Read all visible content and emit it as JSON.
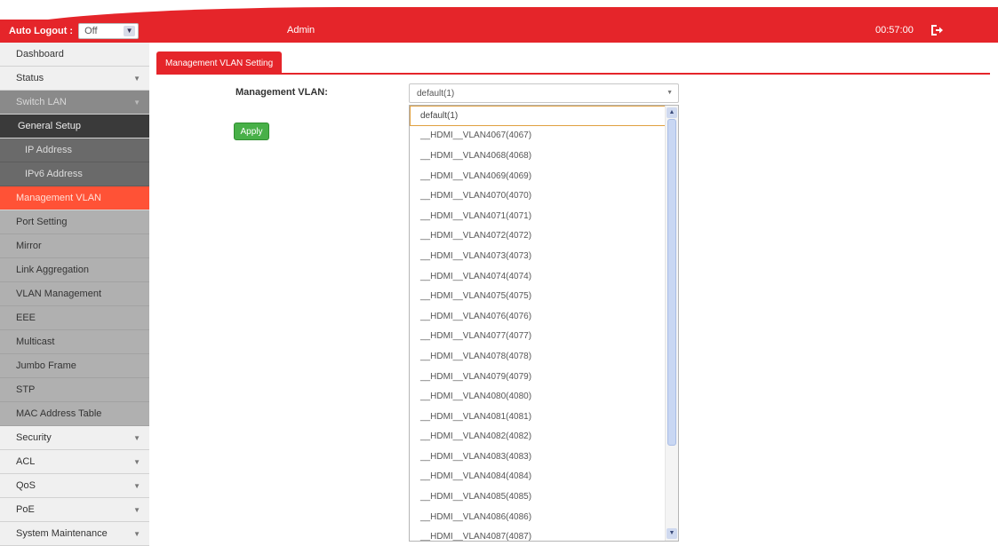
{
  "header": {
    "auto_logout_label": "Auto Logout :",
    "auto_logout_value": "Off",
    "user": "Admin",
    "time": "00:57:00",
    "logout_icon": "logout-icon",
    "color": "#e5252a"
  },
  "sidebar": {
    "items": [
      {
        "label": "Dashboard",
        "type": "normal",
        "chevron": false
      },
      {
        "label": "Status",
        "type": "normal",
        "chevron": true
      },
      {
        "label": "Switch LAN",
        "type": "section",
        "chevron": true
      },
      {
        "label": "General Setup",
        "type": "sub-header",
        "chevron": false
      },
      {
        "label": "IP Address",
        "type": "sub",
        "chevron": false
      },
      {
        "label": "IPv6 Address",
        "type": "sub",
        "chevron": false
      },
      {
        "label": "Management VLAN",
        "type": "active",
        "chevron": false
      },
      {
        "label": "Port Setting",
        "type": "grey",
        "chevron": false
      },
      {
        "label": "Mirror",
        "type": "grey",
        "chevron": false
      },
      {
        "label": "Link Aggregation",
        "type": "grey",
        "chevron": false
      },
      {
        "label": "VLAN Management",
        "type": "grey",
        "chevron": false
      },
      {
        "label": "EEE",
        "type": "grey",
        "chevron": false
      },
      {
        "label": "Multicast",
        "type": "grey",
        "chevron": false
      },
      {
        "label": "Jumbo Frame",
        "type": "grey",
        "chevron": false
      },
      {
        "label": "STP",
        "type": "grey",
        "chevron": false
      },
      {
        "label": "MAC Address Table",
        "type": "grey",
        "chevron": false
      },
      {
        "label": "Security",
        "type": "normal",
        "chevron": true
      },
      {
        "label": "ACL",
        "type": "normal",
        "chevron": true
      },
      {
        "label": "QoS",
        "type": "normal",
        "chevron": true
      },
      {
        "label": "PoE",
        "type": "normal",
        "chevron": true
      },
      {
        "label": "System Maintenance",
        "type": "normal",
        "chevron": true
      }
    ]
  },
  "main": {
    "tab_label": "Management VLAN Setting",
    "field_label": "Management VLAN:",
    "selected_value": "default(1)",
    "apply_label": "Apply",
    "options": [
      "default(1)",
      "__HDMI__VLAN4067(4067)",
      "__HDMI__VLAN4068(4068)",
      "__HDMI__VLAN4069(4069)",
      "__HDMI__VLAN4070(4070)",
      "__HDMI__VLAN4071(4071)",
      "__HDMI__VLAN4072(4072)",
      "__HDMI__VLAN4073(4073)",
      "__HDMI__VLAN4074(4074)",
      "__HDMI__VLAN4075(4075)",
      "__HDMI__VLAN4076(4076)",
      "__HDMI__VLAN4077(4077)",
      "__HDMI__VLAN4078(4078)",
      "__HDMI__VLAN4079(4079)",
      "__HDMI__VLAN4080(4080)",
      "__HDMI__VLAN4081(4081)",
      "__HDMI__VLAN4082(4082)",
      "__HDMI__VLAN4083(4083)",
      "__HDMI__VLAN4084(4084)",
      "__HDMI__VLAN4085(4085)",
      "__HDMI__VLAN4086(4086)",
      "__HDMI__VLAN4087(4087)"
    ]
  }
}
